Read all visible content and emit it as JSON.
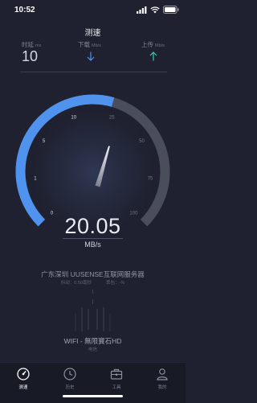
{
  "status": {
    "time": "10:52"
  },
  "header": {
    "title": "测速"
  },
  "metrics": {
    "ping": {
      "label": "时延",
      "unit": "ms",
      "value": "10"
    },
    "download": {
      "label": "下载",
      "unit": "Mb/s"
    },
    "upload": {
      "label": "上传",
      "unit": "Mb/s"
    }
  },
  "gauge": {
    "ticks": [
      "0",
      "1",
      "5",
      "10",
      "25",
      "50",
      "75",
      "100"
    ],
    "progress_fraction": 0.56,
    "speed_value": "20.05",
    "speed_unit": "MB/s"
  },
  "server": {
    "name": "广东深圳 UUSENSE互联网服务器",
    "jitter_label": "抖动：0.50毫秒",
    "loss_label": "丢包：-%"
  },
  "network": {
    "wifi_name": "WIFI - 無限寶石HD",
    "operator": "电信"
  },
  "tabs": [
    {
      "label": "测速",
      "icon": "speedometer-icon",
      "active": true
    },
    {
      "label": "历史",
      "icon": "clock-icon",
      "active": false
    },
    {
      "label": "工具",
      "icon": "toolbox-icon",
      "active": false
    },
    {
      "label": "我的",
      "icon": "user-icon",
      "active": false
    }
  ],
  "colors": {
    "accent": "#4f93ee",
    "background": "#1f2130",
    "upload": "#3fc7b4"
  }
}
